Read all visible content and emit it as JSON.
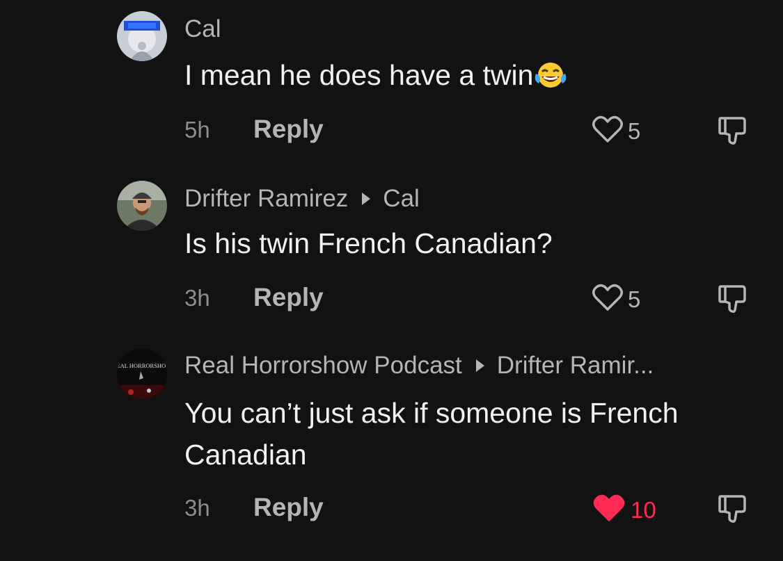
{
  "comments": [
    {
      "author": "Cal",
      "reply_to": "",
      "text": "I mean he does have a twin",
      "emoji": "face-with-tears-of-joy",
      "time": "5h",
      "reply_label": "Reply",
      "likes": "5",
      "liked": false
    },
    {
      "author": "Drifter Ramirez",
      "reply_to": "Cal",
      "text": "Is his twin French Canadian?",
      "time": "3h",
      "reply_label": "Reply",
      "likes": "5",
      "liked": false
    },
    {
      "author": "Real Horrorshow Podcast",
      "reply_to": "Drifter Ramir...",
      "text": "You can’t just ask if someone is French Canadian",
      "avatar_text": "REAL HORRORSHOW",
      "time": "3h",
      "reply_label": "Reply",
      "likes": "10",
      "liked": true
    }
  ],
  "colors": {
    "background": "#121212",
    "liked": "#fe2c55",
    "secondary_text": "#b5b5b5"
  }
}
